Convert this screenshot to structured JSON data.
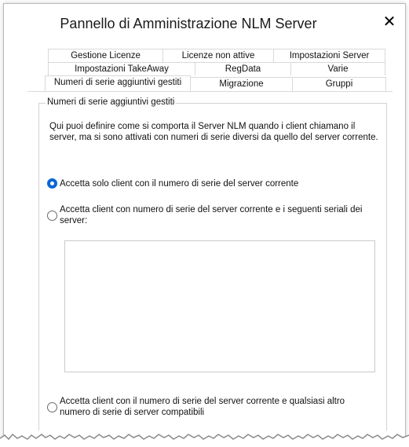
{
  "window": {
    "title": "Pannello di Amministrazione NLM Server",
    "close_glyph": "✕"
  },
  "tabs": {
    "row1": [
      "Gestione Licenze",
      "Licenze non attive",
      "Impostazioni Server"
    ],
    "row2": [
      "Impostazioni TakeAway",
      "RegData",
      "Varie"
    ],
    "row3": [
      "Numeri di serie aggiuntivi gestiti",
      "Migrazione",
      "Gruppi"
    ],
    "active": "Numeri di serie aggiuntivi gestiti"
  },
  "group": {
    "legend": "Numeri di serie aggiuntivi gestiti",
    "description": "Qui puoi definire come si comporta il Server NLM quando i client chiamano il server, ma si sono attivati con numeri di serie diversi da quello del server corrente.",
    "options": [
      {
        "label": "Accetta solo client con il numero di serie del server corrente",
        "selected": true
      },
      {
        "label": "Accetta client con numero di serie del server corrente e i seguenti seriali dei server:",
        "selected": false
      },
      {
        "label": "Accetta client con il numero di serie del server corrente e qualsiasi altro numero di serie di server compatibili",
        "selected": false
      }
    ]
  },
  "colors": {
    "accent": "#0b66d6",
    "border": "#d3d3d3"
  }
}
